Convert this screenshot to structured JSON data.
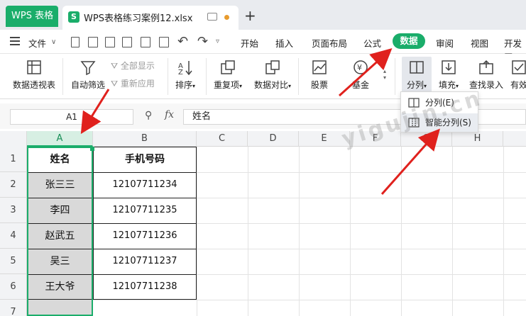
{
  "app": {
    "name": "WPS 表格",
    "brand_color": "#1aad6a"
  },
  "document_tab": {
    "title": "WPS表格练习案例12.xlsx",
    "icon_letter": "S"
  },
  "menu": {
    "file": "文件",
    "tabs": [
      "开始",
      "插入",
      "页面布局",
      "公式",
      "数据",
      "审阅",
      "视图",
      "开发工"
    ],
    "active_tab": "数据"
  },
  "ribbon": {
    "pivot": "数据透视表",
    "autofilter": "自动筛选",
    "show_all": "全部显示",
    "reapply": "重新应用",
    "sort": "排序",
    "duplicates": "重复项",
    "compare": "数据对比",
    "stock": "股票",
    "fund": "基金",
    "split": "分列",
    "fill": "填充",
    "find_enter": "查找录入",
    "valid": "有效"
  },
  "dropdown": {
    "items": [
      "分列(E)",
      "智能分列(S)"
    ]
  },
  "formula_bar": {
    "name_box": "A1",
    "fx": "fx",
    "value": "姓名"
  },
  "grid": {
    "columns": [
      "A",
      "B",
      "C",
      "D",
      "E",
      "F",
      "G",
      "H"
    ],
    "rows": [
      "1",
      "2",
      "3",
      "4",
      "5",
      "6",
      "7"
    ],
    "header": {
      "name": "姓名",
      "phone": "手机号码"
    },
    "data": [
      {
        "name": "张三三",
        "phone": "12107711234"
      },
      {
        "name": "李四",
        "phone": "12107711235"
      },
      {
        "name": "赵武五",
        "phone": "12107711236"
      },
      {
        "name": "吴三",
        "phone": "12107711237"
      },
      {
        "name": "王大爷",
        "phone": "12107711238"
      }
    ]
  },
  "watermark": "yigujin.cn"
}
